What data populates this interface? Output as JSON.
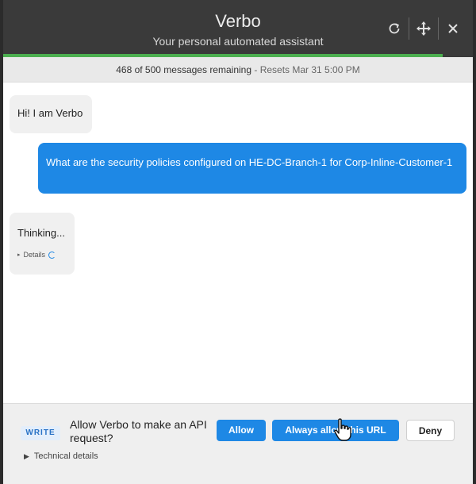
{
  "header": {
    "title": "Verbo",
    "subtitle": "Your personal automated assistant",
    "usage_fraction": 0.936,
    "progress_color": "#4caf50",
    "icons": [
      "refresh-icon",
      "move-icon",
      "close-icon"
    ]
  },
  "status": {
    "remaining": "468 of 500 messages remaining",
    "separator": " - ",
    "reset": "Resets Mar 31 5:00 PM"
  },
  "messages": [
    {
      "role": "assistant",
      "text": "Hi! I am Verbo"
    },
    {
      "role": "user",
      "text": "What are the security policies configured on HE-DC-Branch-1 for Corp-Inline-Customer-1"
    },
    {
      "role": "assistant",
      "text": "Thinking...",
      "details_label": "Details"
    }
  ],
  "approval": {
    "badge": "WRITE",
    "question": "Allow Verbo to make an API request?",
    "allow_label": "Allow",
    "always_allow_label": "Always allow this URL",
    "deny_label": "Deny",
    "technical_details_label": "Technical details"
  },
  "colors": {
    "accent": "#1e88e5",
    "header_bg": "#3a3a3a"
  }
}
